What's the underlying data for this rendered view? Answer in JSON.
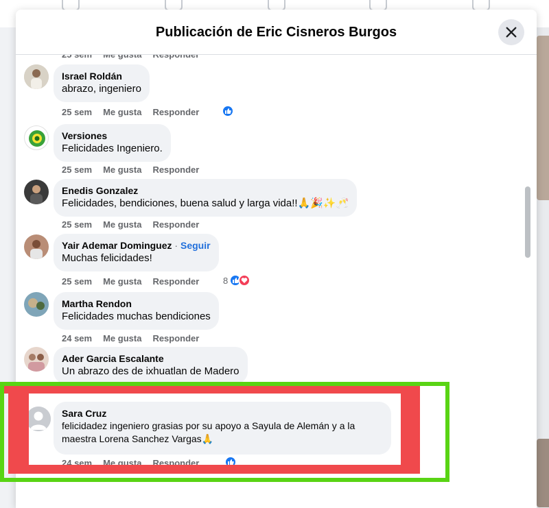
{
  "modal": {
    "title": "Publicación de Eric Cisneros Burgos"
  },
  "actions": {
    "like": "Me gusta",
    "reply": "Responder"
  },
  "top_partial_meta": {
    "time": "25 sem"
  },
  "comments": [
    {
      "author": "Israel Roldán",
      "text": "abrazo, ingeniero",
      "time": "25 sem",
      "reactions": {
        "types": [
          "like"
        ],
        "count": ""
      }
    },
    {
      "author": "Versiones",
      "text": "Felicidades Ingeniero.",
      "time": "25 sem",
      "reactions": null
    },
    {
      "author": "Enedis Gonzalez",
      "text": "Felicidades, bendiciones, buena salud y larga vida!!🙏🎉✨🥂",
      "time": "25 sem",
      "reactions": null
    },
    {
      "author": "Yair Ademar Dominguez",
      "follow": "Seguir",
      "text": "Muchas felicidades!",
      "time": "25 sem",
      "reactions": {
        "types": [
          "like",
          "love"
        ],
        "count": "8"
      }
    },
    {
      "author": "Martha Rendon",
      "text": "Felicidades muchas bendiciones",
      "time": "24 sem",
      "reactions": null
    },
    {
      "author": "Ader Garcia Escalante",
      "text": "Un abrazo des de ixhuatlan de Madero",
      "time": "",
      "reactions": null
    },
    {
      "author": "Sara Cruz",
      "text": "felicidadez ingeniero grasias por su apoyo a Sayula de Alemán y a la maestra Lorena Sanchez Vargas🙏",
      "time": "24 sem",
      "reactions": {
        "types": [
          "like"
        ],
        "count": ""
      }
    }
  ],
  "colors": {
    "highlight_outer": "#59d414",
    "highlight_inner": "#f0494c",
    "like": "#1877f2",
    "love": "#f33e58"
  }
}
